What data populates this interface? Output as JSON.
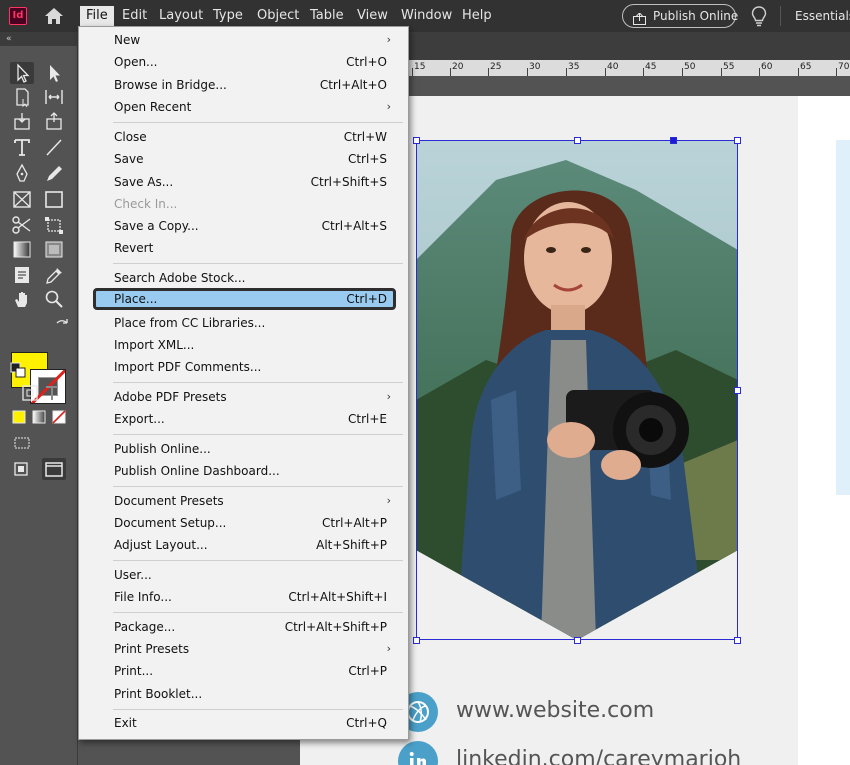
{
  "menubar": {
    "logo": "Id",
    "items": [
      "File",
      "Edit",
      "Layout",
      "Type",
      "Object",
      "Table",
      "View",
      "Window",
      "Help"
    ],
    "active_item": "File",
    "publish_label": "Publish Online",
    "workspace_label": "Essentials"
  },
  "toolpanel": {
    "collapse_glyph": "«",
    "fill_color": "#fff200",
    "stroke_color": "#e0201c"
  },
  "ruler": {
    "labels": [
      "15",
      "20",
      "25",
      "30",
      "35",
      "40",
      "45",
      "50",
      "55",
      "60",
      "65",
      "70"
    ]
  },
  "file_menu": {
    "items": [
      {
        "label": "New",
        "shortcut": "",
        "submenu": true
      },
      {
        "label": "Open...",
        "shortcut": "Ctrl+O"
      },
      {
        "label": "Browse in Bridge...",
        "shortcut": "Ctrl+Alt+O"
      },
      {
        "label": "Open Recent",
        "shortcut": "",
        "submenu": true
      },
      {
        "label": "Close",
        "shortcut": "Ctrl+W"
      },
      {
        "label": "Save",
        "shortcut": "Ctrl+S"
      },
      {
        "label": "Save As...",
        "shortcut": "Ctrl+Shift+S"
      },
      {
        "label": "Check In...",
        "shortcut": "",
        "disabled": true
      },
      {
        "label": "Save a Copy...",
        "shortcut": "Ctrl+Alt+S"
      },
      {
        "label": "Revert",
        "shortcut": ""
      },
      {
        "label": "Search Adobe Stock...",
        "shortcut": ""
      },
      {
        "label": "Place...",
        "shortcut": "Ctrl+D",
        "highlighted": true
      },
      {
        "label": "Place from CC Libraries...",
        "shortcut": ""
      },
      {
        "label": "Import XML...",
        "shortcut": ""
      },
      {
        "label": "Import PDF Comments...",
        "shortcut": ""
      },
      {
        "label": "Adobe PDF Presets",
        "shortcut": "",
        "submenu": true
      },
      {
        "label": "Export...",
        "shortcut": "Ctrl+E"
      },
      {
        "label": "Publish Online...",
        "shortcut": ""
      },
      {
        "label": "Publish Online Dashboard...",
        "shortcut": ""
      },
      {
        "label": "Document Presets",
        "shortcut": "",
        "submenu": true
      },
      {
        "label": "Document Setup...",
        "shortcut": "Ctrl+Alt+P"
      },
      {
        "label": "Adjust Layout...",
        "shortcut": "Alt+Shift+P"
      },
      {
        "label": "User...",
        "shortcut": ""
      },
      {
        "label": "File Info...",
        "shortcut": "Ctrl+Alt+Shift+I"
      },
      {
        "label": "Package...",
        "shortcut": "Ctrl+Alt+Shift+P"
      },
      {
        "label": "Print Presets",
        "shortcut": "",
        "submenu": true
      },
      {
        "label": "Print...",
        "shortcut": "Ctrl+P"
      },
      {
        "label": "Print Booklet...",
        "shortcut": ""
      },
      {
        "label": "Exit",
        "shortcut": "Ctrl+Q"
      }
    ]
  },
  "document": {
    "website": "www.website.com",
    "linkedin": "linkedin.com/careymarioh"
  }
}
